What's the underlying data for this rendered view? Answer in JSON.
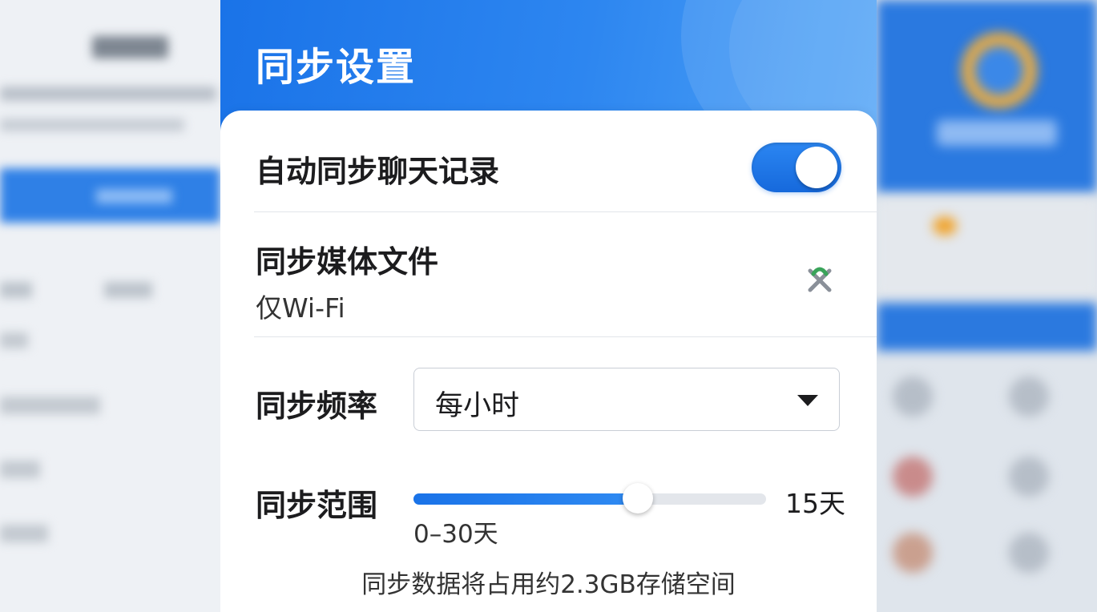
{
  "header": {
    "title": "同步设置"
  },
  "settings": {
    "auto_sync": {
      "label": "自动同步聊天记录",
      "enabled": true
    },
    "media": {
      "label": "同步媒体文件",
      "value": "仅Wi-Fi",
      "icon": "wifi-badge-icon"
    },
    "frequency": {
      "label": "同步频率",
      "selected": "每小时"
    },
    "range": {
      "label": "同步范围",
      "value_text": "15天",
      "value": 15,
      "min": 0,
      "max": 30,
      "hint": "0–30天"
    },
    "storage_note": "同步数据将占用约2.3GB存储空间"
  },
  "colors": {
    "accent": "#1a73e8",
    "header_end": "#4fa3f6"
  }
}
